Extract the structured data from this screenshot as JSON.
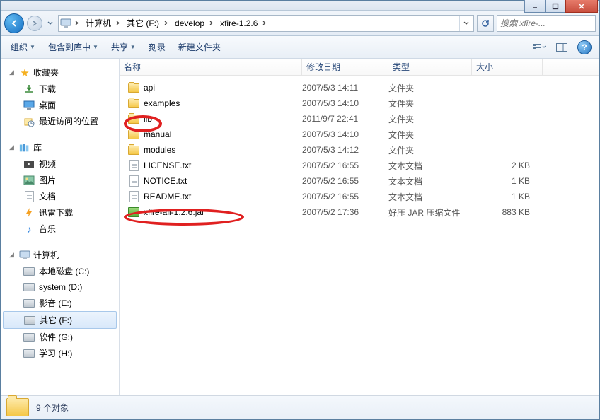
{
  "window": {
    "search_placeholder": "搜索 xfire-..."
  },
  "breadcrumbs": [
    "计算机",
    "其它 (F:)",
    "develop",
    "xfire-1.2.6"
  ],
  "toolbar": {
    "organize": "组织",
    "include": "包含到库中",
    "share": "共享",
    "burn": "刻录",
    "newfolder": "新建文件夹"
  },
  "sidebar": {
    "favorites": {
      "label": "收藏夹",
      "items": [
        "下载",
        "桌面",
        "最近访问的位置"
      ]
    },
    "libraries": {
      "label": "库",
      "items": [
        "视频",
        "图片",
        "文档",
        "迅雷下载",
        "音乐"
      ]
    },
    "computer": {
      "label": "计算机",
      "items": [
        "本地磁盘 (C:)",
        "system (D:)",
        "影音 (E:)",
        "其它 (F:)",
        "软件 (G:)",
        "学习 (H:)"
      ],
      "selected_index": 3
    }
  },
  "columns": {
    "name": "名称",
    "date": "修改日期",
    "type": "类型",
    "size": "大小"
  },
  "files": [
    {
      "icon": "folder",
      "name": "api",
      "date": "2007/5/3 14:11",
      "type": "文件夹",
      "size": ""
    },
    {
      "icon": "folder",
      "name": "examples",
      "date": "2007/5/3 14:10",
      "type": "文件夹",
      "size": ""
    },
    {
      "icon": "folder",
      "name": "lib",
      "date": "2011/9/7 22:41",
      "type": "文件夹",
      "size": ""
    },
    {
      "icon": "folder",
      "name": "manual",
      "date": "2007/5/3 14:10",
      "type": "文件夹",
      "size": ""
    },
    {
      "icon": "folder",
      "name": "modules",
      "date": "2007/5/3 14:12",
      "type": "文件夹",
      "size": ""
    },
    {
      "icon": "file",
      "name": "LICENSE.txt",
      "date": "2007/5/2 16:55",
      "type": "文本文档",
      "size": "2 KB"
    },
    {
      "icon": "file",
      "name": "NOTICE.txt",
      "date": "2007/5/2 16:55",
      "type": "文本文档",
      "size": "1 KB"
    },
    {
      "icon": "file",
      "name": "README.txt",
      "date": "2007/5/2 16:55",
      "type": "文本文档",
      "size": "1 KB"
    },
    {
      "icon": "jar",
      "name": "xfire-all-1.2.6.jar",
      "date": "2007/5/2 17:36",
      "type": "好压 JAR 压缩文件",
      "size": "883 KB"
    }
  ],
  "status": {
    "count_text": "9 个对象"
  }
}
